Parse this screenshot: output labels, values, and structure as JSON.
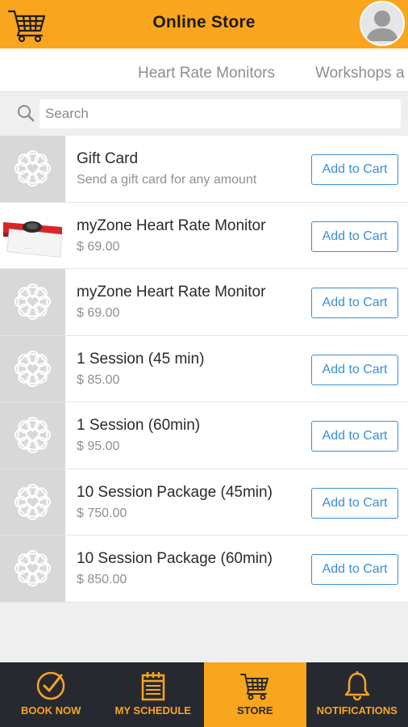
{
  "header": {
    "title": "Online Store"
  },
  "categories": [
    {
      "label": "Heart Rate Monitors"
    },
    {
      "label": "Workshops a"
    }
  ],
  "search": {
    "placeholder": "Search",
    "value": ""
  },
  "products": [
    {
      "name": "Gift Card",
      "subtitle": "Send a gift card for any amount",
      "button": "Add to Cart",
      "image": "placeholder"
    },
    {
      "name": "myZone Heart Rate Monitor",
      "subtitle": "$ 69.00",
      "button": "Add to Cart",
      "image": "heart-rate-strap-photo"
    },
    {
      "name": "myZone Heart Rate Monitor",
      "subtitle": "$ 69.00",
      "button": "Add to Cart",
      "image": "placeholder"
    },
    {
      "name": "1 Session (45 min)",
      "subtitle": "$ 85.00",
      "button": "Add to Cart",
      "image": "placeholder"
    },
    {
      "name": "1 Session (60min)",
      "subtitle": "$ 95.00",
      "button": "Add to Cart",
      "image": "placeholder"
    },
    {
      "name": "10 Session Package (45min)",
      "subtitle": "$ 750.00",
      "button": "Add to Cart",
      "image": "placeholder"
    },
    {
      "name": "10 Session Package (60min)",
      "subtitle": "$ 850.00",
      "button": "Add to Cart",
      "image": "placeholder"
    }
  ],
  "bottom_nav": [
    {
      "label": "BOOK NOW",
      "icon": "check-circle-icon",
      "active": false
    },
    {
      "label": "MY SCHEDULE",
      "icon": "calendar-icon",
      "active": false
    },
    {
      "label": "STORE",
      "icon": "cart-icon",
      "active": true
    },
    {
      "label": "NOTIFICATIONS",
      "icon": "bell-icon",
      "active": false
    }
  ],
  "colors": {
    "accent": "#f9a51d",
    "button_blue": "#3a8ed6",
    "nav_dark": "#272930"
  }
}
